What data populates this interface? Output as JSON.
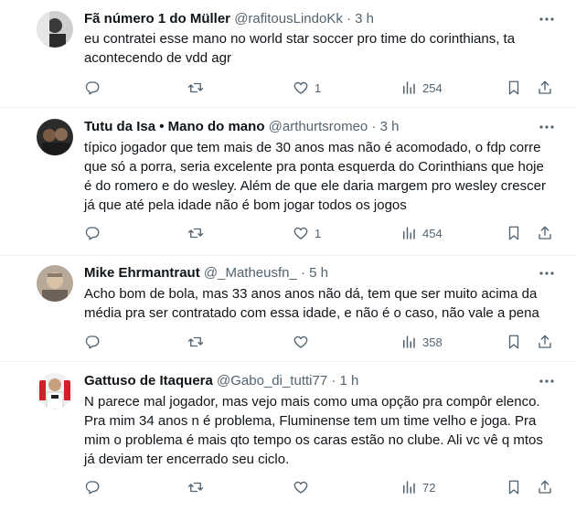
{
  "tweets": [
    {
      "name": "Fã número 1 do Müller",
      "handle": "@rafitousLindoKk",
      "time": "3 h",
      "lines": [
        "eu contratei esse mano no world star soccer pro time do corinthians, ta",
        "acontecendo de vdd agr"
      ],
      "likes": "1",
      "views": "254",
      "replies": "",
      "retweets": ""
    },
    {
      "name": "Tutu da Isa • Mano do mano",
      "handle": "@arthurtsromeo",
      "time": "3 h",
      "lines": [
        "típico jogador que tem mais de 30 anos mas não é acomodado, o fdp corre",
        "que só a porra, seria excelente pra ponta esquerda do Corinthians que hoje",
        "é do romero e do wesley. Além de que ele daria margem pro wesley crescer",
        "já que até pela idade não é bom jogar todos os jogos"
      ],
      "likes": "1",
      "views": "454",
      "replies": "",
      "retweets": ""
    },
    {
      "name": "Mike Ehrmantraut",
      "handle": "@_Matheusfn_",
      "time": "5 h",
      "lines": [
        "Acho bom de bola, mas 33 anos anos não dá, tem que ser muito acima da",
        "média pra ser contratado com essa idade, e não é o caso, não vale a pena"
      ],
      "likes": "",
      "views": "358",
      "replies": "",
      "retweets": ""
    },
    {
      "name": "Gattuso de Itaquera",
      "handle": "@Gabo_di_tutti77",
      "time": "1 h",
      "lines": [
        "N parece mal jogador, mas vejo mais como uma opção pra compôr elenco.",
        "Pra mim 34 anos n é problema, Fluminense tem um time velho e joga. Pra",
        "mim o problema é mais qto tempo os caras estão no clube. Ali vc vê q mtos",
        "já deviam ter encerrado seu ciclo."
      ],
      "likes": "",
      "views": "72",
      "replies": "",
      "retweets": ""
    }
  ],
  "icons": {
    "reply": "reply-icon",
    "retweet": "retweet-icon",
    "like": "heart-icon",
    "views": "views-icon",
    "bookmark": "bookmark-icon",
    "share": "share-icon",
    "more": "more-icon"
  },
  "colors": {
    "secondary_text": "#536471",
    "divider": "#eff3f4",
    "primary_text": "#0f1419"
  }
}
